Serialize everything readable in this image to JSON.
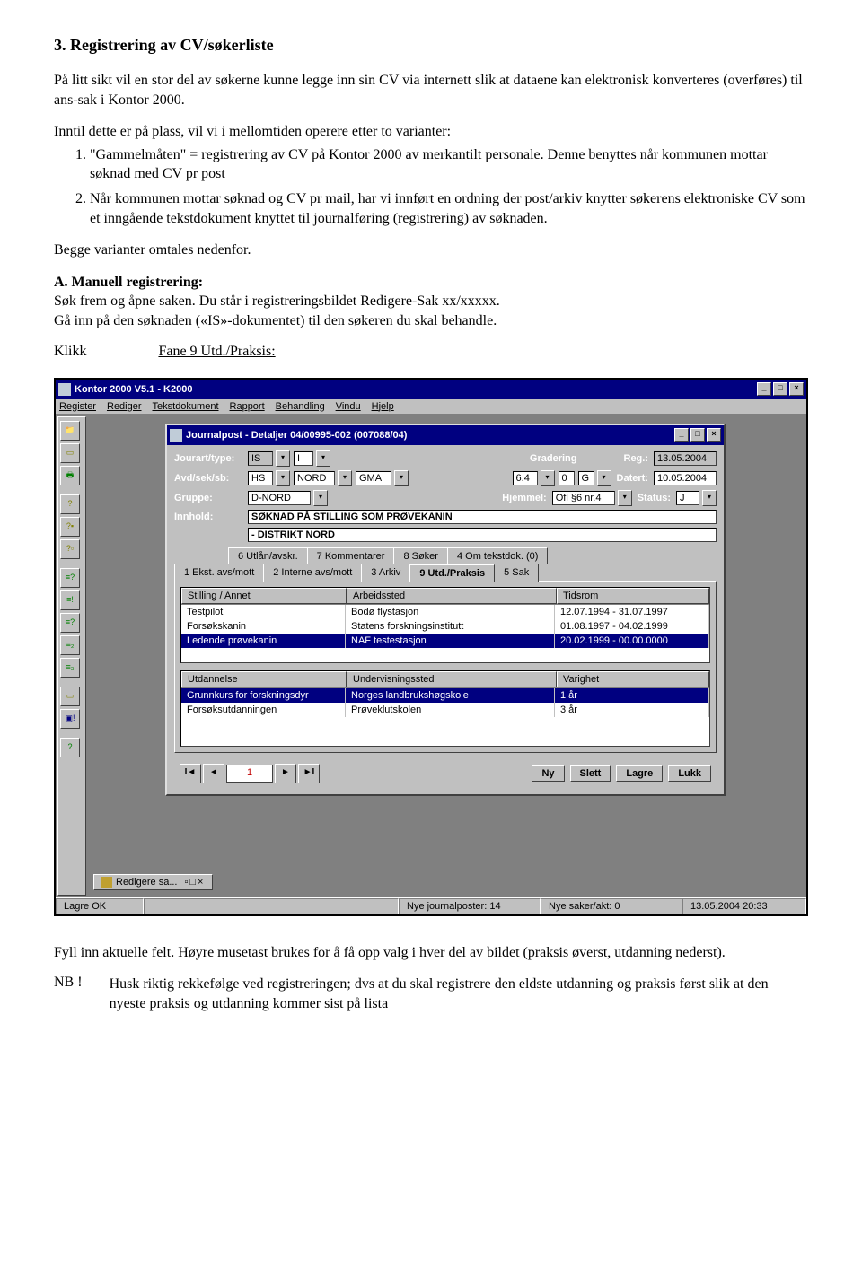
{
  "doc": {
    "heading": "3. Registrering av CV/søkerliste",
    "intro": "På litt sikt vil en stor del av søkerne kunne legge inn sin CV via internett slik at dataene kan elektronisk konverteres (overføres) til ans-sak i Kontor 2000.",
    "variant_intro": "Inntil dette er på plass, vil vi i mellomtiden operere etter to varianter:",
    "li1": "\"Gammelmåten\" = registrering av CV på Kontor 2000 av merkantilt personale. Denne benyttes når kommunen mottar søknad med CV pr post",
    "li2": "Når kommunen mottar søknad og CV pr mail, har vi innført en ordning der post/arkiv knytter søkerens elektroniske CV som et inngående tekstdokument knyttet til journalføring (registrering) av søknaden.",
    "begge": "Begge varianter omtales nedenfor.",
    "manuell_head": "A. Manuell registrering:",
    "manuell_1": "Søk frem og åpne saken. Du står i registreringsbildet Redigere-Sak xx/xxxxx.",
    "manuell_2": "Gå inn på den søknaden («IS»-dokumentet) til den søkeren du skal behandle.",
    "klikk_label": "Klikk",
    "klikk_target": "Fane 9 Utd./Praksis:",
    "fyll": "Fyll inn aktuelle felt. Høyre musetast brukes for å få opp valg i hver del av bildet (praksis øverst, utdanning nederst).",
    "nb_label": "NB !",
    "nb_body": "Husk riktig rekkefølge ved registreringen; dvs at du skal registrere den eldste utdanning og praksis først slik at den nyeste praksis og utdanning kommer sist på lista"
  },
  "app": {
    "title": "Kontor 2000 V5.1 - K2000",
    "menus": [
      "Register",
      "Rediger",
      "Tekstdokument",
      "Rapport",
      "Behandling",
      "Vindu",
      "Hjelp"
    ],
    "child_title": "Journalpost - Detaljer 04/00995-002 (007088/04)",
    "labels": {
      "jourart": "Jourart/type:",
      "gradering": "Gradering",
      "reg": "Reg.:",
      "avd": "Avd/sek/sb:",
      "datert": "Datert:",
      "gruppe": "Gruppe:",
      "hjemmel": "Hjemmel:",
      "status": "Status:",
      "innhold": "Innhold:"
    },
    "fields": {
      "jourart1": "IS",
      "jourart2": "I",
      "reg": "13.05.2004",
      "avd1": "HS",
      "avd2": "NORD",
      "avd3": "GMA",
      "g1": "6.4",
      "g2": "0",
      "g3": "G",
      "datert": "10.05.2004",
      "gruppe": "D-NORD",
      "hjemmel": "Ofl §6 nr.4",
      "status": "J",
      "innhold1": "SØKNAD PÅ STILLING SOM PRØVEKANIN",
      "innhold2": "- DISTRIKT NORD"
    },
    "tabs_top": [
      {
        "label": "6 Utlån/avskr."
      },
      {
        "label": "7 Kommentarer"
      },
      {
        "label": "8 Søker"
      },
      {
        "label": "4 Om tekstdok. (0)"
      }
    ],
    "tabs_bottom": [
      {
        "label": "1 Ekst. avs/mott"
      },
      {
        "label": "2 Interne avs/mott"
      },
      {
        "label": "3 Arkiv"
      },
      {
        "label": "9 Utd./Praksis",
        "active": true
      },
      {
        "label": "5 Sak"
      }
    ],
    "praksis": {
      "cols": [
        "Stilling / Annet",
        "Arbeidssted",
        "Tidsrom"
      ],
      "rows": [
        {
          "a": "Testpilot",
          "b": "Bodø flystasjon",
          "c": "12.07.1994 - 31.07.1997"
        },
        {
          "a": "Forsøkskanin",
          "b": "Statens forskningsinstitutt",
          "c": "01.08.1997 - 04.02.1999"
        },
        {
          "a": "Ledende prøvekanin",
          "b": "NAF testestasjon",
          "c": "20.02.1999 - 00.00.0000",
          "selected": true
        }
      ]
    },
    "utdanning": {
      "cols": [
        "Utdannelse",
        "Undervisningssted",
        "Varighet"
      ],
      "rows": [
        {
          "a": "Grunnkurs for forskningsdyr",
          "b": "Norges landbrukshøgskole",
          "c": "1 år",
          "selected": true
        },
        {
          "a": "Forsøksutdanningen",
          "b": "Prøveklutskolen",
          "c": "3 år"
        }
      ]
    },
    "nav": {
      "count": "1",
      "btns": [
        "Ny",
        "Slett",
        "Lagre",
        "Lukk"
      ]
    },
    "taskbtn": "Redigere sa...",
    "status": {
      "s1": "Lagre OK",
      "s3": "Nye journalposter: 14",
      "s4": "Nye saker/akt: 0",
      "s5": "13.05.2004 20:33"
    }
  }
}
